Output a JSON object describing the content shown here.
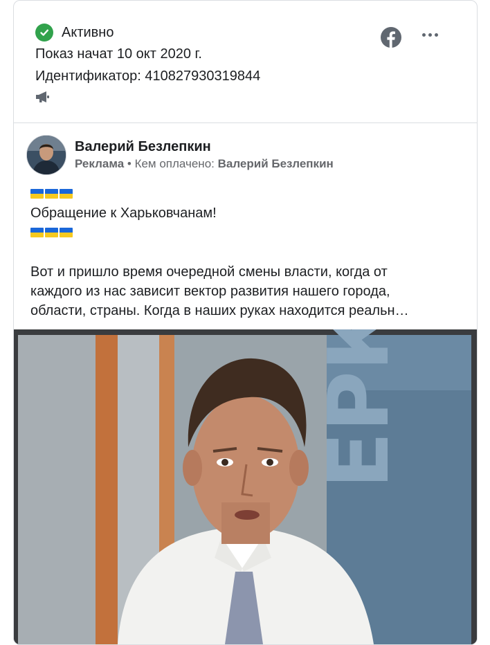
{
  "status": {
    "label": "Активно",
    "color": "#31a24c"
  },
  "ad_info": {
    "started": "Показ начат 10 окт 2020 г.",
    "identifier": "Идентификатор: 410827930319844"
  },
  "icons": {
    "platform": "facebook-icon",
    "placement": "megaphone-icon",
    "menu": "more-options-icon"
  },
  "post": {
    "page_name": "Валерий Безлепкин",
    "sponsored_label": "Реклама",
    "separator": " • ",
    "paid_by_label": "Кем оплачено: ",
    "paid_by_name": "Валерий Безлепкин",
    "headline": "Обращение к Харьковчанам!",
    "body_lines": [
      "Вот и пришло время очередной смены власти, когда от",
      "каждого из нас зависит вектор развития нашего города,",
      "области, страны. Когда в наших руках находится реальн…"
    ]
  },
  "colors": {
    "facebook_blue": "#606770",
    "flag_blue": "#1a67d9",
    "flag_yellow": "#f6c91f"
  }
}
